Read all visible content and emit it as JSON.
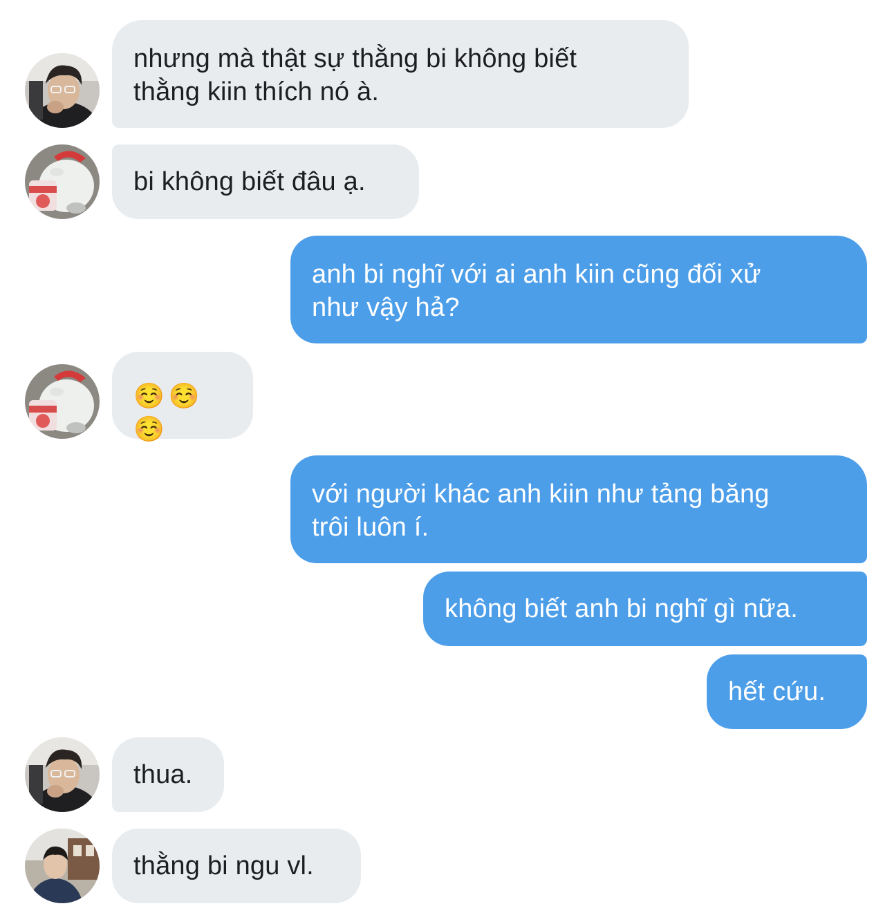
{
  "conversation": {
    "messages": [
      {
        "sender": "incoming",
        "text": "nhưng mà thật sự thằng bi không biết\nthằng kiin thích nó à."
      },
      {
        "sender": "incoming",
        "text": "bi không biết đâu ạ."
      },
      {
        "sender": "outgoing",
        "text": "anh bi nghĩ với ai anh kiin cũng đối xử\nnhư vậy hả?"
      },
      {
        "sender": "incoming",
        "text": "☺️☺️☺️"
      },
      {
        "sender": "outgoing",
        "text": "với người khác anh kiin như tảng băng\ntrôi luôn í."
      },
      {
        "sender": "outgoing",
        "text": "không biết anh bi nghĩ gì nữa."
      },
      {
        "sender": "outgoing",
        "text": "hết cứu."
      },
      {
        "sender": "incoming",
        "text": "thua."
      },
      {
        "sender": "incoming",
        "text": "thằng bi ngu vl."
      }
    ]
  },
  "colors": {
    "incoming_bubble": "#e9ecef",
    "outgoing_bubble": "#4d9ee9",
    "incoming_text": "#1c1e21",
    "outgoing_text": "#ffffff"
  },
  "avatars": {
    "boy_photo": "avatar-boy-photo",
    "bear_sticker": "avatar-bear-icecream",
    "street_photo": "avatar-street-photo"
  }
}
